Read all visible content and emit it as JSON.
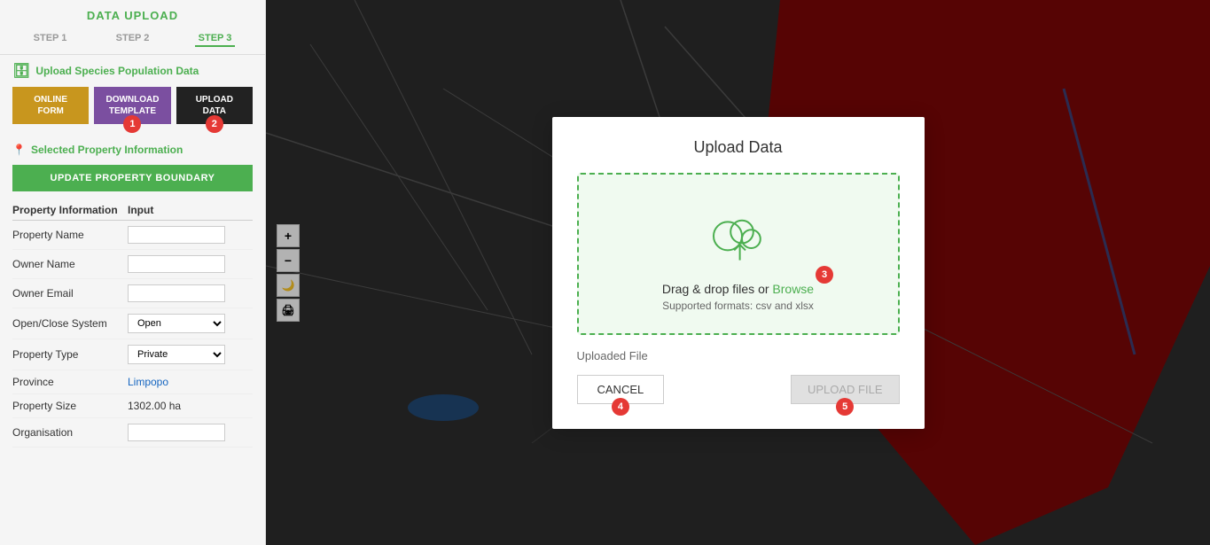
{
  "sidebar": {
    "header": "DATA UPLOAD",
    "steps": [
      {
        "id": "step1",
        "label": "STEP 1",
        "active": false
      },
      {
        "id": "step2",
        "label": "STEP 2",
        "active": false
      },
      {
        "id": "step3",
        "label": "STEP 3",
        "active": true
      }
    ],
    "upload_species_label": "Upload Species Population Data",
    "buttons": {
      "online_form": "ONLINE\nFORM",
      "online_form_line1": "ONLINE",
      "online_form_line2": "FORM",
      "download_template_line1": "DOWNLOAD",
      "download_template_line2": "TEMPLATE",
      "upload_data_line1": "UPLOAD",
      "upload_data_line2": "DATA"
    },
    "badge_download": "1",
    "badge_upload": "2",
    "selected_property_label": "Selected Property Information",
    "update_boundary_btn": "UPDATE PROPERTY BOUNDARY",
    "table_headers": {
      "col1": "Property Information",
      "col2": "Input"
    },
    "property_rows": [
      {
        "label": "Property Name",
        "type": "input",
        "value": ""
      },
      {
        "label": "Owner Name",
        "type": "input",
        "value": ""
      },
      {
        "label": "Owner Email",
        "type": "input",
        "value": ""
      },
      {
        "label": "Open/Close System",
        "type": "select",
        "value": "Open"
      },
      {
        "label": "Property Type",
        "type": "select",
        "value": "Private"
      },
      {
        "label": "Province",
        "type": "text",
        "value": "Limpopo",
        "color": "blue"
      },
      {
        "label": "Property Size",
        "type": "text",
        "value": "1302.00 ha"
      },
      {
        "label": "Organisation",
        "type": "input",
        "value": ""
      }
    ]
  },
  "modal": {
    "title": "Upload Data",
    "dropzone": {
      "text": "Drag & drop files or ",
      "link_text": "Browse",
      "badge": "3",
      "formats": "Supported formats: csv and xlsx"
    },
    "uploaded_file_label": "Uploaded File",
    "buttons": {
      "cancel": "CANCEL",
      "cancel_badge": "4",
      "upload_file": "UPLOAD FILE",
      "upload_file_badge": "5"
    }
  },
  "map": {
    "zoom_in": "+",
    "zoom_out": "−",
    "controls": [
      "🌙",
      "🖨"
    ]
  }
}
